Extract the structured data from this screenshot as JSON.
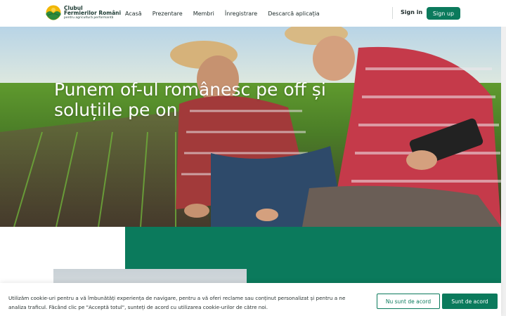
{
  "brand": {
    "name_line1": "Clubul",
    "name_line2": "Fermierilor Români",
    "tagline": "pentru agricultură performantă"
  },
  "nav": {
    "items": [
      "Acasă",
      "Prezentare",
      "Membri",
      "Înregistrare",
      "Descarcă aplicația"
    ]
  },
  "auth": {
    "sign_in": "Sign in",
    "sign_up": "Sign up"
  },
  "hero": {
    "title": "Punem of-ul românesc pe off și soluțiile pe on"
  },
  "cookie": {
    "text": "Utilizăm cookie-uri pentru a vă îmbunătăți experiența de navigare, pentru a vă oferi reclame sau conținut personalizat și pentru a ne analiza traficul. Făcând clic pe \"Acceptă totul\", sunteți de acord cu utilizarea cookie-urilor de către noi.",
    "decline": "Nu sunt de acord",
    "accept": "Sunt de acord"
  },
  "colors": {
    "brand_green": "#0b7a5c",
    "text_dark": "#1d2b2a"
  }
}
